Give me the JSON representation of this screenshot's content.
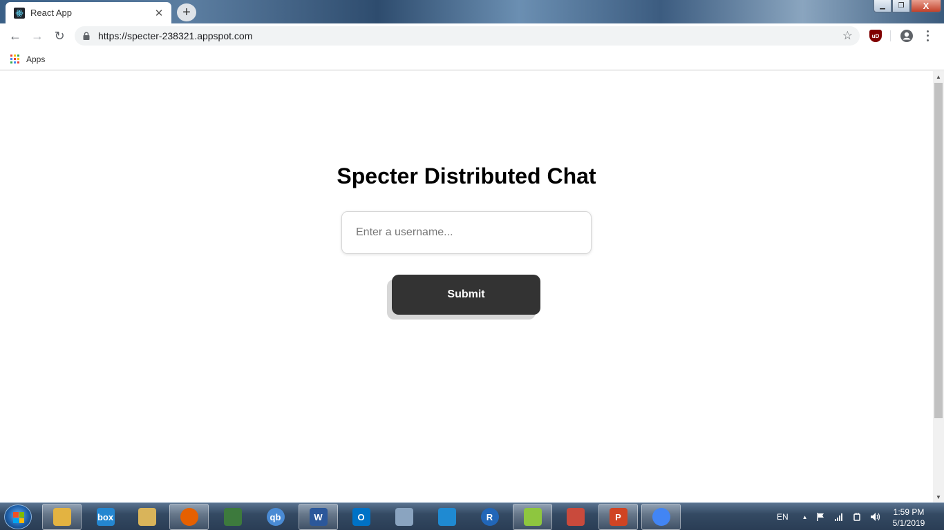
{
  "browser": {
    "tab": {
      "title": "React App",
      "close_glyph": "✕"
    },
    "new_tab_glyph": "+",
    "window_controls": {
      "minimize": "▁",
      "maximize": "❐",
      "close": "X"
    },
    "toolbar": {
      "back_glyph": "←",
      "forward_glyph": "→",
      "reload_glyph": "↻",
      "url": "https://specter-238321.appspot.com",
      "star_glyph": "☆",
      "extension_label": "uD"
    },
    "bookmarks": {
      "apps_label": "Apps"
    }
  },
  "page": {
    "title": "Specter Distributed Chat",
    "username_input": {
      "placeholder": "Enter a username...",
      "value": ""
    },
    "submit_label": "Submit"
  },
  "scrollbar": {
    "up_glyph": "▲",
    "down_glyph": "▼"
  },
  "taskbar": {
    "apps": [
      {
        "name": "file-explorer-icon",
        "label": "",
        "color": "#e3b341"
      },
      {
        "name": "box-icon",
        "label": "box",
        "color": "#2486d0"
      },
      {
        "name": "folder-icon",
        "label": "",
        "color": "#d9b45a"
      },
      {
        "name": "firefox-icon",
        "label": "",
        "color": "#e66000"
      },
      {
        "name": "task-manager-icon",
        "label": "",
        "color": "#3d7a3d"
      },
      {
        "name": "qbittorrent-icon",
        "label": "qb",
        "color": "#4a8bd4"
      },
      {
        "name": "word-icon",
        "label": "W",
        "color": "#2b579a"
      },
      {
        "name": "outlook-icon",
        "label": "O",
        "color": "#0072c6"
      },
      {
        "name": "calculator-icon",
        "label": "",
        "color": "#8aa4c0"
      },
      {
        "name": "vscode-icon",
        "label": "",
        "color": "#1f8ad2"
      },
      {
        "name": "r-icon",
        "label": "R",
        "color": "#2166b8"
      },
      {
        "name": "notepad-plus-plus-icon",
        "label": "",
        "color": "#8ec63f"
      },
      {
        "name": "git-icon",
        "label": "",
        "color": "#c94a3c"
      },
      {
        "name": "powerpoint-icon",
        "label": "P",
        "color": "#d04423"
      },
      {
        "name": "chrome-icon",
        "label": "",
        "color": "#4285f4"
      }
    ],
    "tray": {
      "language": "EN",
      "show_hidden_glyph": "▲"
    },
    "clock": {
      "time": "1:59 PM",
      "date": "5/1/2019"
    }
  }
}
